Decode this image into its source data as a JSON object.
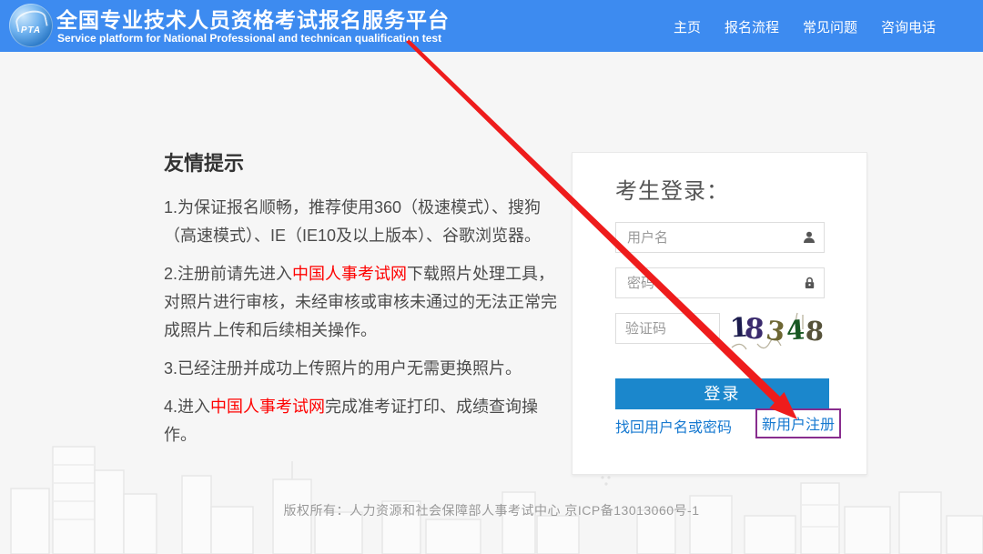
{
  "colors": {
    "header_bg": "#3d8bf0",
    "login_button_bg": "#1b87cc",
    "link_blue": "#1679d0",
    "tip_link_red": "#fe0100",
    "register_border_purple": "#882d8e",
    "arrow_red": "#ee1c1c",
    "captcha_digit_colors": [
      "#1b1b4d",
      "#3a2a6d",
      "#6e6733",
      "#175722",
      "#56523a"
    ]
  },
  "header": {
    "logo_text": "PTA",
    "title": "全国专业技术人员资格考试报名服务平台",
    "subtitle": "Service platform for National Professional and technican qualification test",
    "nav": [
      {
        "label": "主页"
      },
      {
        "label": "报名流程"
      },
      {
        "label": "常见问题"
      },
      {
        "label": "咨询电话"
      }
    ]
  },
  "tips": {
    "heading": "友情提示",
    "items": [
      {
        "segments": [
          {
            "text": "1.为保证报名顺畅，推荐使用360（极速模式）、搜狗（高速模式）、IE（IE10及以上版本）、谷歌浏览器。"
          }
        ]
      },
      {
        "segments": [
          {
            "text": "2.注册前请先进入"
          },
          {
            "text": "中国人事考试网",
            "red": true
          },
          {
            "text": "下载照片处理工具，对照片进行审核，未经审核或审核未通过的无法正常完成照片上传和后续相关操作。"
          }
        ]
      },
      {
        "segments": [
          {
            "text": "3.已经注册并成功上传照片的用户无需更换照片。"
          }
        ]
      },
      {
        "segments": [
          {
            "text": "4.进入"
          },
          {
            "text": "中国人事考试网",
            "red": true
          },
          {
            "text": "完成准考证打印、成绩查询操作。"
          }
        ]
      }
    ]
  },
  "login": {
    "heading": "考生登录：",
    "username_placeholder": "用户名",
    "password_placeholder": "密码",
    "captcha_placeholder": "验证码",
    "captcha": {
      "value": "18348",
      "digits": [
        {
          "char": "1"
        },
        {
          "char": "8"
        },
        {
          "char": "3"
        },
        {
          "char": "4"
        },
        {
          "char": "8"
        }
      ]
    },
    "login_button": "登录",
    "forgot_link": "找回用户名或密码",
    "register_link": "新用户注册"
  },
  "footer": {
    "copyright": "版权所有：人力资源和社会保障部人事考试中心 京ICP备13013060号-1"
  }
}
